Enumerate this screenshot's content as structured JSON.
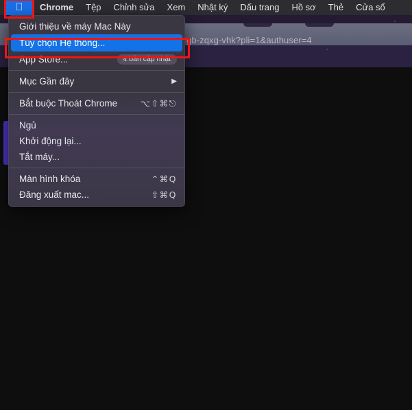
{
  "menubar": {
    "apple_icon": "apple-logo-icon",
    "items": [
      {
        "label": "Chrome",
        "bold": true
      },
      {
        "label": "Tệp",
        "bold": false
      },
      {
        "label": "Chỉnh sửa",
        "bold": false
      },
      {
        "label": "Xem",
        "bold": false
      },
      {
        "label": "Nhật ký",
        "bold": false
      },
      {
        "label": "Dấu trang",
        "bold": false
      },
      {
        "label": "Hồ sơ",
        "bold": false
      },
      {
        "label": "Thẻ",
        "bold": false
      },
      {
        "label": "Cửa sổ",
        "bold": false
      }
    ]
  },
  "apple_menu": {
    "about": {
      "label": "Giới thiệu về máy Mac Này"
    },
    "system_preferences": {
      "label": "Tùy chọn Hệ thống...",
      "selected": true
    },
    "app_store": {
      "label": "App Store...",
      "badge": "4 bản cập nhật"
    },
    "recent_items": {
      "label": "Mục Gần đây",
      "arrow": "▶"
    },
    "force_quit": {
      "label": "Bắt buộc Thoát Chrome",
      "shortcut": "⌥⇧⌘⎋"
    },
    "sleep": {
      "label": "Ngủ"
    },
    "restart": {
      "label": "Khởi động lại..."
    },
    "shutdown": {
      "label": "Tắt máy..."
    },
    "lock_screen": {
      "label": "Màn hình khóa",
      "shortcut": "⌃⌘Q"
    },
    "log_out": {
      "label": "Đăng xuất mac...",
      "shortcut": "⇧⌘Q"
    }
  },
  "background_window": {
    "url_text": "gb-zqxg-vhk?pli=1&authuser=4"
  },
  "colors": {
    "highlight_blue": "#1472e8",
    "annotation_red": "#ee1515",
    "menubar_bg": "#2c2c31",
    "menu_bg": "#3a3742",
    "desktop_bg": "#0e0e0e",
    "purple_accent": "#4b35c4"
  }
}
